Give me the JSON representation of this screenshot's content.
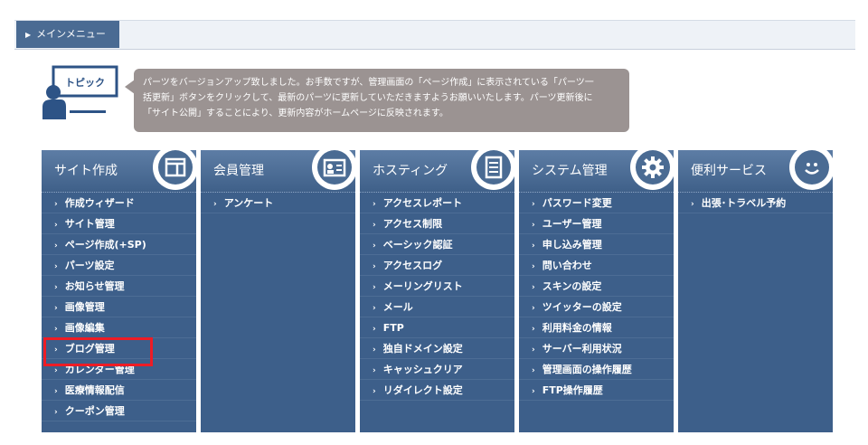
{
  "header": {
    "menu_label": "メインメニュー"
  },
  "topic": {
    "icon_label": "トピック",
    "lines": [
      "パーツをバージョンアップ致しました。お手数ですが、管理画面の「ページ作成」に表示されている「パーツ一",
      "括更新」ボタンをクリックして、最新のパーツに更新していただきますようお願いいたします。パーツ更新後に",
      "「サイト公開」することにより、更新内容がホームページに反映されます。"
    ]
  },
  "columns": [
    {
      "title": "サイト作成",
      "icon": "layout-icon",
      "items": [
        "作成ウィザード",
        "サイト管理",
        "ページ作成(+SP)",
        "パーツ設定",
        "お知らせ管理",
        "画像管理",
        "画像編集",
        "ブログ管理",
        "カレンダー管理",
        "医療情報配信",
        "クーポン管理"
      ]
    },
    {
      "title": "会員管理",
      "icon": "member-card-icon",
      "items": [
        "アンケート"
      ]
    },
    {
      "title": "ホスティング",
      "icon": "document-icon",
      "items": [
        "アクセスレポート",
        "アクセス制限",
        "ベーシック認証",
        "アクセスログ",
        "メーリングリスト",
        "メール",
        "FTP",
        "独自ドメイン設定",
        "キャッシュクリア",
        "リダイレクト設定"
      ]
    },
    {
      "title": "システム管理",
      "icon": "gear-icon",
      "items": [
        "パスワード変更",
        "ユーザー管理",
        "申し込み管理",
        "問い合わせ",
        "スキンの設定",
        "ツイッターの設定",
        "利用料金の情報",
        "サーバー利用状況",
        "管理画面の操作履歴",
        "FTP操作履歴"
      ]
    },
    {
      "title": "便利サービス",
      "icon": "smile-icon",
      "items": [
        "出張･トラベル予約"
      ]
    }
  ],
  "highlighted_item": "ブログ管理",
  "colors": {
    "panel": "#3d5f8a",
    "highlight": "#ee1c25",
    "bubble": "#9b9392"
  }
}
